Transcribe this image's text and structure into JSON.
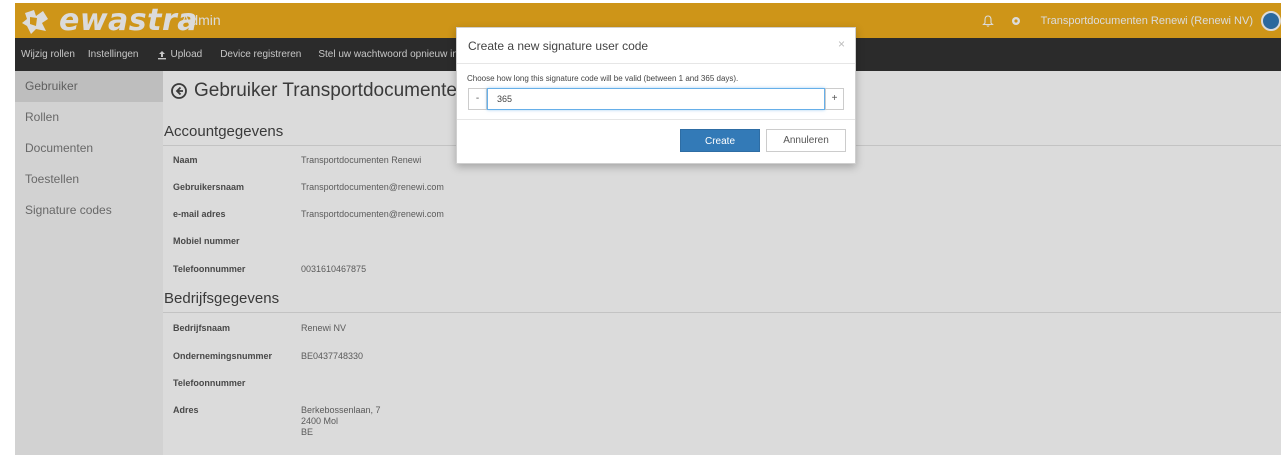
{
  "colors": {
    "topbar": "#f0ae1d",
    "subnav": "#333333",
    "primary": "#337ab7"
  },
  "header": {
    "logo_text": "ewastra",
    "admin_label": "Admin",
    "user_label": "Transportdocumenten Renewi (Renewi NV)"
  },
  "subnav": {
    "items": [
      "Wijzig rollen",
      "Instellingen",
      "Upload",
      "Device registreren",
      "Stel uw wachtwoord opnieuw in"
    ]
  },
  "sidebar": {
    "items": [
      "Gebruiker",
      "Rollen",
      "Documenten",
      "Toestellen",
      "Signature codes"
    ]
  },
  "main": {
    "page_title": "Gebruiker Transportdocumenten R",
    "account_section": "Accountgegevens",
    "account_rows": [
      {
        "label": "Naam",
        "value": "Transportdocumenten Renewi"
      },
      {
        "label": "Gebruikersnaam",
        "value": "Transportdocumenten@renewi.com"
      },
      {
        "label": "e-mail adres",
        "value": "Transportdocumenten@renewi.com"
      },
      {
        "label": "Mobiel nummer",
        "value": ""
      },
      {
        "label": "Telefoonnummer",
        "value": "0031610467875"
      }
    ],
    "company_section": "Bedrijfsgegevens",
    "company_rows": [
      {
        "label": "Bedrijfsnaam",
        "value": "Renewi NV"
      },
      {
        "label": "Ondernemingsnummer",
        "value": "BE0437748330"
      },
      {
        "label": "Telefoonnummer",
        "value": ""
      }
    ],
    "address": {
      "label": "Adres",
      "line1": "Berkebossenlaan, 7",
      "line2": "2400 Mol",
      "line3": "BE"
    }
  },
  "modal": {
    "title": "Create a new signature user code",
    "close": "×",
    "hint": "Choose how long this signature code will be valid (between 1 and 365 days).",
    "minus": "-",
    "plus": "+",
    "value": "365",
    "create_label": "Create",
    "cancel_label": "Annuleren"
  }
}
